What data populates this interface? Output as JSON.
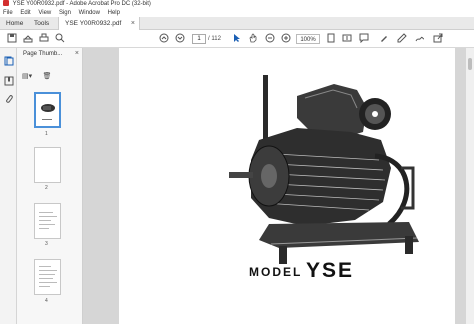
{
  "window": {
    "title": "YSE Y00R0932.pdf - Adobe Acrobat Pro DC (32-bit)"
  },
  "menu": {
    "items": [
      "File",
      "Edit",
      "View",
      "Sign",
      "Window",
      "Help"
    ]
  },
  "tabs": {
    "home": "Home",
    "tools": "Tools",
    "document": "YSE Y00R0932.pdf",
    "close": "×"
  },
  "toolbar": {
    "page_current": "1",
    "page_total": "/ 112",
    "zoom": "100%"
  },
  "thumbnails": {
    "header": "Page Thumb...",
    "close": "×",
    "pages": [
      "1",
      "2",
      "3",
      "4"
    ]
  },
  "page": {
    "model_label": "MODEL",
    "model_name": "YSE"
  },
  "colors": {
    "acrobat_red": "#d32f2f",
    "selection_blue": "#4a90d9",
    "doc_background": "#d6d6d6"
  }
}
